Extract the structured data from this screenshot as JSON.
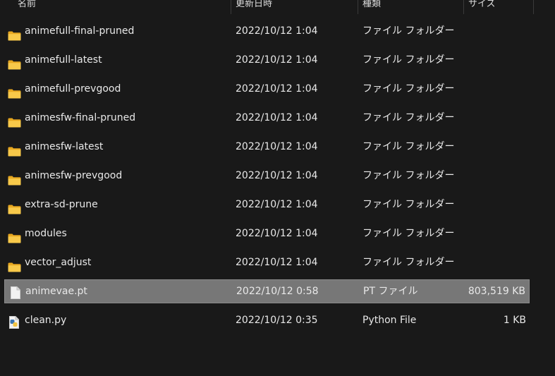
{
  "columns": {
    "name": "名前",
    "date": "更新日時",
    "type": "種類",
    "size": "サイズ"
  },
  "rows": [
    {
      "icon": "folder-icon",
      "name": "animefull-final-pruned",
      "date": "2022/10/12 1:04",
      "type": "ファイル フォルダー",
      "size": ""
    },
    {
      "icon": "folder-icon",
      "name": "animefull-latest",
      "date": "2022/10/12 1:04",
      "type": "ファイル フォルダー",
      "size": ""
    },
    {
      "icon": "folder-icon",
      "name": "animefull-prevgood",
      "date": "2022/10/12 1:04",
      "type": "ファイル フォルダー",
      "size": ""
    },
    {
      "icon": "folder-icon",
      "name": "animesfw-final-pruned",
      "date": "2022/10/12 1:04",
      "type": "ファイル フォルダー",
      "size": ""
    },
    {
      "icon": "folder-icon",
      "name": "animesfw-latest",
      "date": "2022/10/12 1:04",
      "type": "ファイル フォルダー",
      "size": ""
    },
    {
      "icon": "folder-icon",
      "name": "animesfw-prevgood",
      "date": "2022/10/12 1:04",
      "type": "ファイル フォルダー",
      "size": ""
    },
    {
      "icon": "folder-icon",
      "name": "extra-sd-prune",
      "date": "2022/10/12 1:04",
      "type": "ファイル フォルダー",
      "size": ""
    },
    {
      "icon": "folder-icon",
      "name": "modules",
      "date": "2022/10/12 1:04",
      "type": "ファイル フォルダー",
      "size": ""
    },
    {
      "icon": "folder-icon",
      "name": "vector_adjust",
      "date": "2022/10/12 1:04",
      "type": "ファイル フォルダー",
      "size": ""
    },
    {
      "icon": "file-icon",
      "name": "animevae.pt",
      "date": "2022/10/12 0:58",
      "type": "PT ファイル",
      "size": "803,519 KB",
      "selected": true
    },
    {
      "icon": "python-file-icon",
      "name": "clean.py",
      "date": "2022/10/12 0:35",
      "type": "Python File",
      "size": "1 KB"
    }
  ],
  "colors": {
    "background": "#191919",
    "selected_row": "#777777",
    "folder_yellow": "#f8c94a"
  }
}
